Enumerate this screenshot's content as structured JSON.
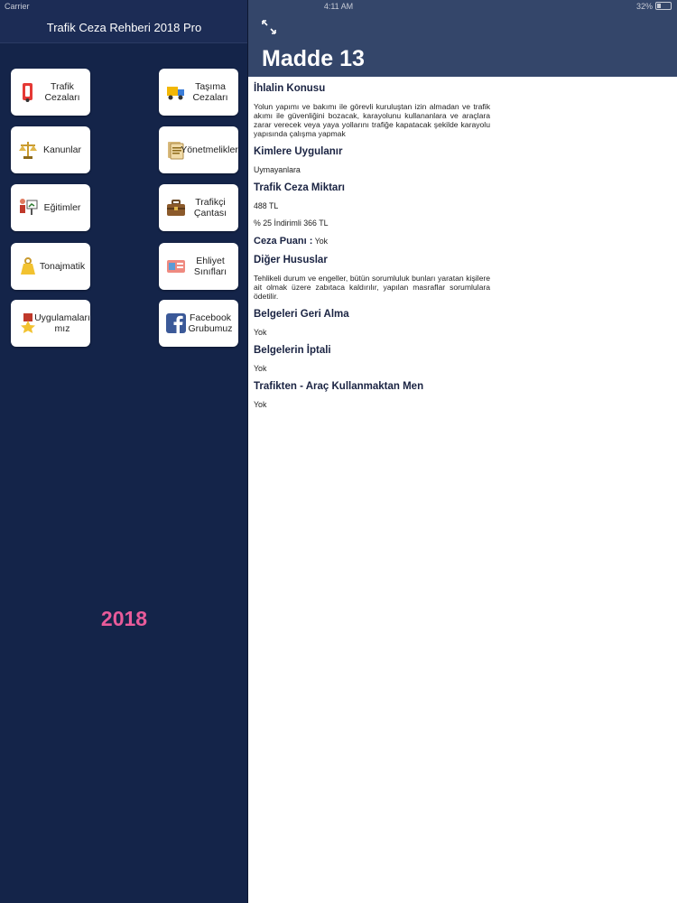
{
  "status_bar": {
    "carrier": "Carrier",
    "time": "4:11 AM",
    "battery": "32%"
  },
  "sidebar": {
    "title": "Trafik Ceza Rehberi 2018 Pro",
    "tiles": [
      {
        "label": "Trafik\nCezaları",
        "icon": "traffic-light-icon"
      },
      {
        "label": "Taşıma\nCezaları",
        "icon": "truck-icon"
      },
      {
        "label": "Kanunlar",
        "icon": "scales-icon"
      },
      {
        "label": "Yönetmelikler",
        "icon": "document-icon"
      },
      {
        "label": "Eğitimler",
        "icon": "presentation-icon"
      },
      {
        "label": "Trafikçi\nÇantası",
        "icon": "briefcase-icon"
      },
      {
        "label": "Tonajmatik",
        "icon": "weight-icon"
      },
      {
        "label": "Ehliyet\nSınıfları",
        "icon": "license-icon"
      },
      {
        "label": "Uygulamaları\nmız",
        "icon": "medal-icon"
      },
      {
        "label": "Facebook\nGrubumuz",
        "icon": "facebook-icon"
      }
    ],
    "year": "2018"
  },
  "detail": {
    "title": "Madde 13",
    "sections": {
      "violation_heading": "İhlalin Konusu",
      "violation_text": "Yolun yapımı ve bakımı ile görevli kuruluştan izin almadan ve trafik akımı ile güvenliğini bozacak, karayolunu kullananlara ve araçlara zarar verecek veya yaya yollarını trafiğe kapatacak şekilde karayolu yapısında çalışma yapmak",
      "applies_heading": "Kimlere Uygulanır",
      "applies_text": "Uymayanlara",
      "amount_heading": "Trafik Ceza Miktarı",
      "amount": "488 TL",
      "discount": "% 25 İndirimli 366 TL",
      "points_label": "Ceza Puanı :",
      "points_value": "Yok",
      "other_heading": "Diğer Hususlar",
      "other_text": "Tehlikeli durum ve engeller, bütün sorumluluk bunları yaratan kişilere ait olmak üzere zabıtaca kaldırılır, yapılan masraflar sorumlulara ödetilir.",
      "return_heading": "Belgeleri Geri Alma",
      "return_value": "Yok",
      "cancel_heading": "Belgelerin İptali",
      "cancel_value": "Yok",
      "ban_heading": "Trafikten - Araç Kullanmaktan Men",
      "ban_value": "Yok"
    }
  }
}
